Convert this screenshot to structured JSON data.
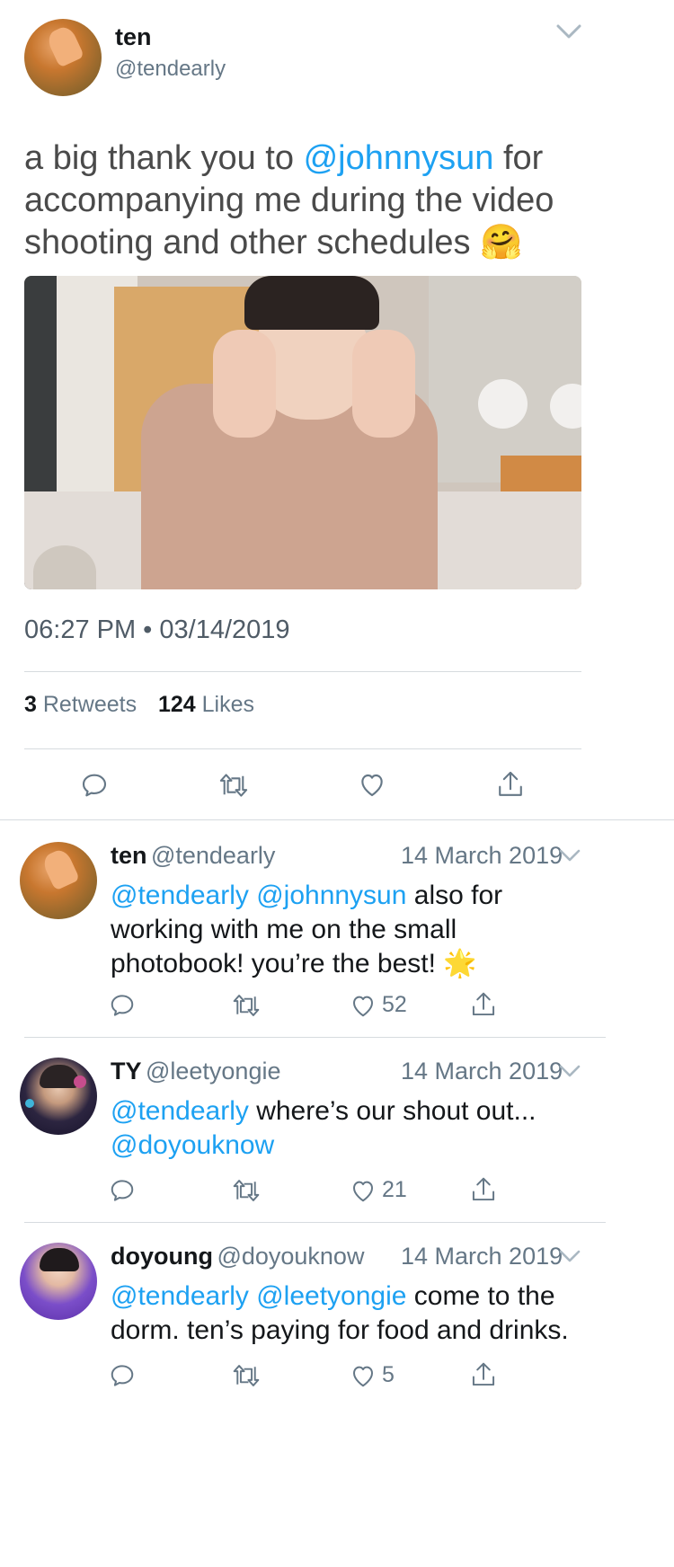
{
  "main_tweet": {
    "name": "ten",
    "handle": "@tendearly",
    "text_prefix": "a big thank you to ",
    "text_mention": "@johnnysun",
    "text_suffix": " for accompanying me during the video shooting and other schedules",
    "emoji": "🤗",
    "timestamp": "06:27 PM • 03/14/2019",
    "retweets_count": "3",
    "retweets_label": "Retweets",
    "likes_count": "124",
    "likes_label": "Likes"
  },
  "replies": [
    {
      "name": "ten",
      "handle": "@tendearly",
      "date": "14 March 2019",
      "mentions": "@tendearly @johnnysun",
      "text": " also for working with me on the small photobook! you’re the best! ",
      "emoji": "🌟",
      "likes": "52"
    },
    {
      "name": "TY",
      "handle": "@leetyongie",
      "date": "14 March 2019",
      "mentions": "@tendearly",
      "text": " where’s our shout out... ",
      "mention2": "@doyouknow",
      "likes": "21"
    },
    {
      "name": "doyoung",
      "handle": "@doyouknow",
      "date": "14 March 2019",
      "mentions": "@tendearly @leetyongie",
      "text": " come to the dorm. ten’s paying for food and drinks.",
      "likes": "5"
    }
  ],
  "colors": {
    "link": "#1da1f2",
    "muted": "#657786",
    "text": "#14171a",
    "divider": "#d6dbdf"
  },
  "icons": [
    "reply-icon",
    "retweet-icon",
    "like-icon",
    "share-icon",
    "chevron-down-icon"
  ]
}
